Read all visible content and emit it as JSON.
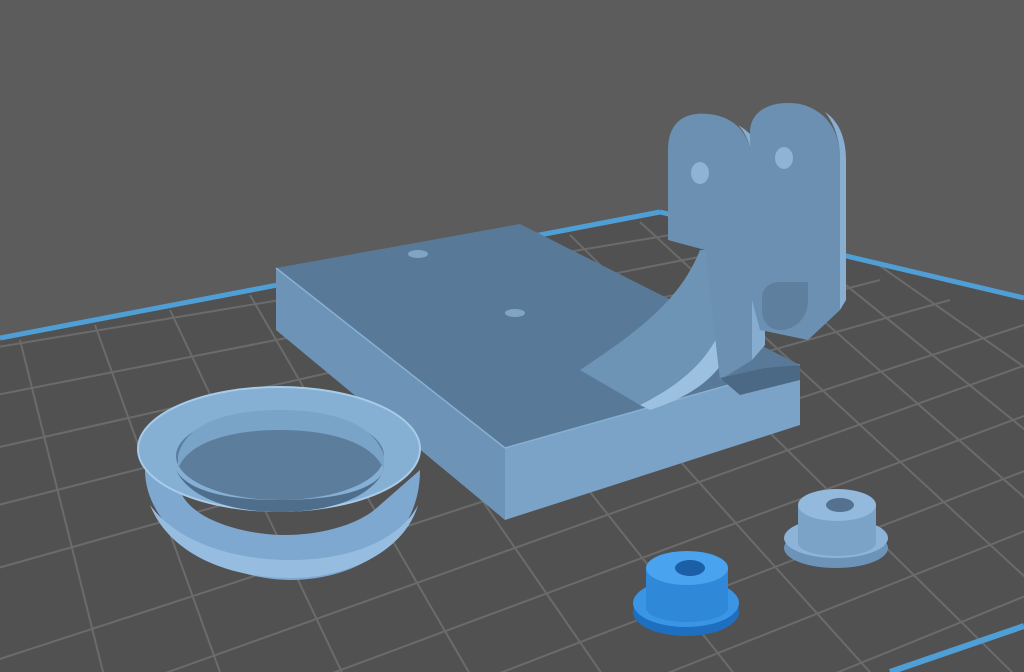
{
  "viewport": {
    "background_color": "#5c5c5c",
    "bed_color": "#515151",
    "grid_line_color": "#6b6b6b",
    "bed_edge_color": "#4f9fd6"
  },
  "objects": [
    {
      "name": "bracket-base-plate",
      "kind": "mounting-bracket",
      "color": "#6b93b7",
      "selected": false
    },
    {
      "name": "v-groove-wheel",
      "kind": "pulley-wheel",
      "color": "#7ea8cf",
      "selected": false
    },
    {
      "name": "flanged-bushing-small",
      "kind": "bushing",
      "color": "#7ea8cf",
      "selected": false
    },
    {
      "name": "flanged-bushing-selected",
      "kind": "bushing",
      "color": "#2f8fe0",
      "selected": true
    }
  ]
}
